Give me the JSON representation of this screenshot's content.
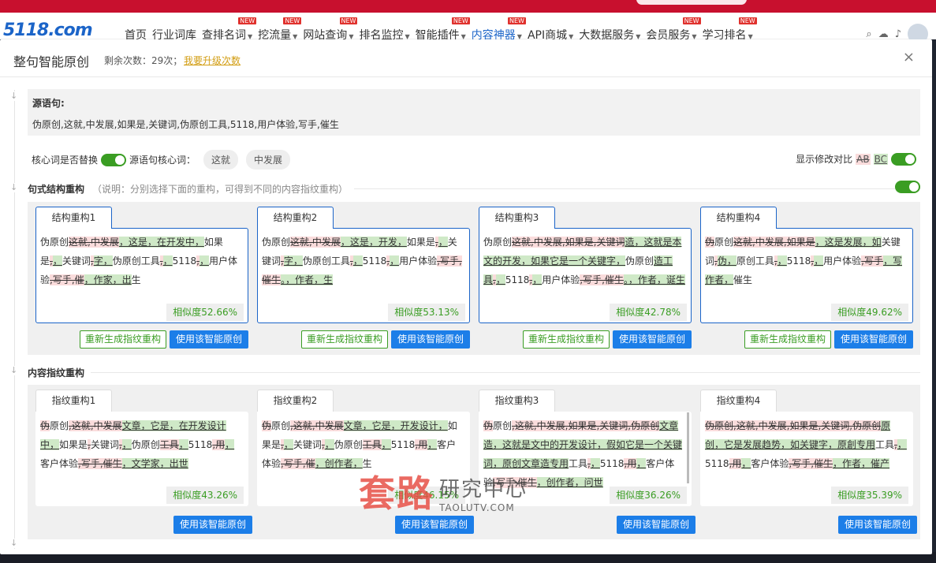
{
  "nav": {
    "logo": "5118.com",
    "items": [
      {
        "label": "首页",
        "new": false,
        "caret": false
      },
      {
        "label": "行业词库",
        "new": false,
        "caret": false
      },
      {
        "label": "查排名词",
        "new": true,
        "caret": true
      },
      {
        "label": "挖流量",
        "new": true,
        "caret": true
      },
      {
        "label": "网站查询",
        "new": true,
        "caret": true
      },
      {
        "label": "排名监控",
        "new": false,
        "caret": true
      },
      {
        "label": "智能插件",
        "new": true,
        "caret": true
      },
      {
        "label": "内容神器",
        "new": true,
        "caret": true,
        "active": true
      },
      {
        "label": "API商城",
        "new": false,
        "caret": true
      },
      {
        "label": "大数据服务",
        "new": false,
        "caret": true
      },
      {
        "label": "会员服务",
        "new": true,
        "caret": true
      },
      {
        "label": "学习排名",
        "new": true,
        "caret": true
      }
    ],
    "new_badge": "NEW"
  },
  "dialog": {
    "title": "整句智能原创",
    "remain": "剩余次数：29次；",
    "upgrade": "我要升级次数",
    "close": "×"
  },
  "source": {
    "label": "源语句:",
    "text": "伪原创,这就,中发展,如果是,关键词,伪原创工具,5118,用户体验,写手,催生"
  },
  "options": {
    "replace_label": "核心词是否替换",
    "core_label": "源语句核心词：",
    "core_words": [
      "这就",
      "中发展"
    ],
    "compare_label": "显示修改对比",
    "compare_ab": "AB",
    "compare_bc": "BC"
  },
  "section1": {
    "title": "句式结构重构",
    "note": "（说明：分别选择下面的重构，可得到不同的内容指纹重构）"
  },
  "section2": {
    "title": "内容指纹重构"
  },
  "buttons": {
    "regen": "重新生成指纹重构",
    "use": "使用该智能原创"
  },
  "structure_cards": [
    {
      "tab": "结构重构1",
      "similarity": "相似度52.66%",
      "segments": [
        [
          "n",
          "伪原创"
        ],
        [
          "d",
          "这就,中发展"
        ],
        [
          "i",
          "，这是，在开发中，"
        ],
        [
          "n",
          "如果是"
        ],
        [
          "d",
          ","
        ],
        [
          "i",
          "，"
        ],
        [
          "n",
          "关键词"
        ],
        [
          "d",
          ","
        ],
        [
          "i",
          "字，"
        ],
        [
          "n",
          "伪原创工具"
        ],
        [
          "d",
          ","
        ],
        [
          "i",
          "，"
        ],
        [
          "n",
          "5118"
        ],
        [
          "d",
          ","
        ],
        [
          "i",
          "，"
        ],
        [
          "n",
          "用户体验"
        ],
        [
          "d",
          ",写手,催"
        ],
        [
          "i",
          "，作家，出"
        ],
        [
          "n",
          "生"
        ]
      ]
    },
    {
      "tab": "结构重构2",
      "similarity": "相似度53.13%",
      "segments": [
        [
          "n",
          "伪原创"
        ],
        [
          "d",
          "这就,中发展"
        ],
        [
          "i",
          "，这是，开发，"
        ],
        [
          "n",
          "如果是"
        ],
        [
          "d",
          ","
        ],
        [
          "i",
          "，"
        ],
        [
          "n",
          "关键词"
        ],
        [
          "d",
          ","
        ],
        [
          "i",
          "字，"
        ],
        [
          "n",
          "伪原创工具"
        ],
        [
          "d",
          ","
        ],
        [
          "i",
          "，"
        ],
        [
          "n",
          "5118"
        ],
        [
          "d",
          ","
        ],
        [
          "i",
          "，"
        ],
        [
          "n",
          "用户体验"
        ],
        [
          "d",
          ",写手,催生"
        ],
        [
          "i",
          "。，作者，生"
        ]
      ]
    },
    {
      "tab": "结构重构3",
      "similarity": "相似度42.78%",
      "segments": [
        [
          "n",
          "伪原创"
        ],
        [
          "d",
          "这就,中发展,如果是,关键词"
        ],
        [
          "i",
          "造，这就是本文的开发，如果它是一个关键字，"
        ],
        [
          "n",
          "伪原创"
        ],
        [
          "i",
          "造工具"
        ],
        [
          "d",
          ","
        ],
        [
          "i",
          "，"
        ],
        [
          "n",
          "5118"
        ],
        [
          "d",
          ","
        ],
        [
          "i",
          "，"
        ],
        [
          "n",
          "用户体验"
        ],
        [
          "d",
          ",写手,催生"
        ],
        [
          "i",
          "。，作者，诞生"
        ]
      ]
    },
    {
      "tab": "结构重构4",
      "similarity": "相似度49.62%",
      "segments": [
        [
          "d",
          "伪"
        ],
        [
          "n",
          "原创"
        ],
        [
          "d",
          "这就,中发展,如果是"
        ],
        [
          "i",
          "，这是发展，如"
        ],
        [
          "n",
          "关键词"
        ],
        [
          "d",
          ","
        ],
        [
          "i",
          "伪，"
        ],
        [
          "n",
          "原创工具"
        ],
        [
          "d",
          ","
        ],
        [
          "i",
          "，"
        ],
        [
          "n",
          "5118"
        ],
        [
          "d",
          ","
        ],
        [
          "i",
          "，"
        ],
        [
          "n",
          "用户体验"
        ],
        [
          "d",
          ",写手"
        ],
        [
          "i",
          "，写作者，"
        ],
        [
          "n",
          "催生"
        ]
      ]
    }
  ],
  "fingerprint_cards": [
    {
      "tab": "指纹重构1",
      "similarity": "相似度43.26%",
      "segments": [
        [
          "d",
          "伪"
        ],
        [
          "n",
          "原创"
        ],
        [
          "d",
          ",这就,中发展"
        ],
        [
          "i",
          "文章，它是，在开发设计中，"
        ],
        [
          "n",
          "如果是"
        ],
        [
          "d",
          ","
        ],
        [
          "n",
          "关键词"
        ],
        [
          "d",
          ","
        ],
        [
          "i",
          "，"
        ],
        [
          "n",
          "伪原创"
        ],
        [
          "d",
          "工具"
        ],
        [
          "i",
          "，"
        ],
        [
          "n",
          "5118"
        ],
        [
          "d",
          ",用"
        ],
        [
          "i",
          "，"
        ],
        [
          "n",
          "客户体验"
        ],
        [
          "d",
          ",写手,催生"
        ],
        [
          "i",
          "，文学家，出世"
        ]
      ]
    },
    {
      "tab": "指纹重构2",
      "similarity": "相似度46.15%",
      "segments": [
        [
          "d",
          "伪"
        ],
        [
          "n",
          "原创"
        ],
        [
          "d",
          ",这就,中发展"
        ],
        [
          "i",
          "文章，它是，开发设计，"
        ],
        [
          "n",
          "如果是"
        ],
        [
          "d",
          ","
        ],
        [
          "i",
          "，"
        ],
        [
          "n",
          "关键词"
        ],
        [
          "d",
          ","
        ],
        [
          "i",
          "，"
        ],
        [
          "n",
          "伪原创"
        ],
        [
          "d",
          "工具"
        ],
        [
          "i",
          "，"
        ],
        [
          "n",
          "5118"
        ],
        [
          "d",
          ",用"
        ],
        [
          "i",
          "，"
        ],
        [
          "n",
          "客户体验"
        ],
        [
          "d",
          ",写手,催"
        ],
        [
          "i",
          "，创作者，"
        ],
        [
          "n",
          "生"
        ]
      ]
    },
    {
      "tab": "指纹重构3",
      "similarity": "相似度36.26%",
      "segments": [
        [
          "d",
          "伪"
        ],
        [
          "n",
          "原创"
        ],
        [
          "d",
          ",这就,中发展,如果是,关键词,伪原创"
        ],
        [
          "i",
          "文章造，这就是文中的开发设计，假如它是一个关键词，原创文章造专用"
        ],
        [
          "n",
          "工具"
        ],
        [
          "d",
          ","
        ],
        [
          "i",
          "，"
        ],
        [
          "n",
          "5118"
        ],
        [
          "d",
          ",用"
        ],
        [
          "i",
          "，"
        ],
        [
          "n",
          "客户体验"
        ],
        [
          "d",
          ",写手,催生"
        ],
        [
          "i",
          "，创作者，问世"
        ]
      ]
    },
    {
      "tab": "指纹重构4",
      "similarity": "相似度35.39%",
      "segments": [
        [
          "d",
          "伪原创,这就,中发展,如果是,关键词,伪原创"
        ],
        [
          "i",
          "原创，它是发展趋势，如关键字，原創专用"
        ],
        [
          "n",
          "工具"
        ],
        [
          "d",
          ","
        ],
        [
          "i",
          "，"
        ],
        [
          "n",
          "5118"
        ],
        [
          "d",
          ",用"
        ],
        [
          "i",
          "，"
        ],
        [
          "n",
          "客户体验"
        ],
        [
          "d",
          ",写手,催生"
        ],
        [
          "i",
          "，作者，催产"
        ]
      ]
    }
  ],
  "watermark": {
    "main": "套路",
    "sub": "研究中心",
    "url": "TAOLUTV.COM"
  }
}
